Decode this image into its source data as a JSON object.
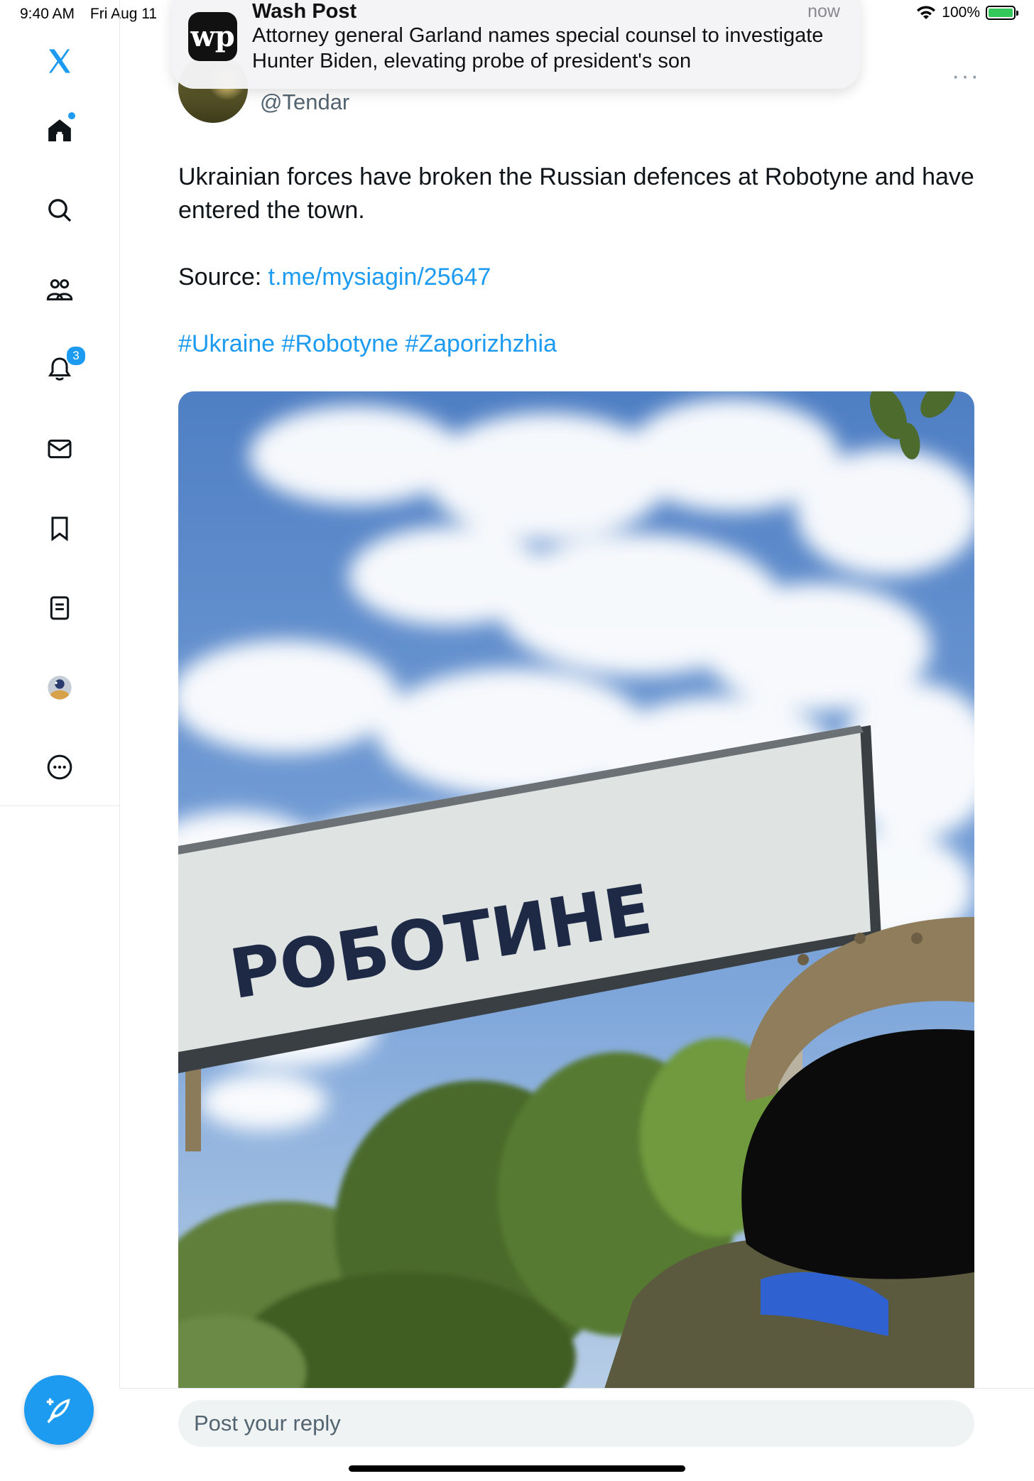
{
  "status_bar": {
    "time": "9:40 AM",
    "date": "Fri Aug 11",
    "battery": "100%"
  },
  "sidebar": {
    "items": [
      {
        "name": "x-logo",
        "icon": "x-logo-icon"
      },
      {
        "name": "home",
        "icon": "home-icon"
      },
      {
        "name": "explore",
        "icon": "search-icon"
      },
      {
        "name": "communities",
        "icon": "communities-icon"
      },
      {
        "name": "notifications",
        "icon": "bell-icon",
        "badge": "3"
      },
      {
        "name": "messages",
        "icon": "mail-icon"
      },
      {
        "name": "bookmarks",
        "icon": "bookmark-icon"
      },
      {
        "name": "lists",
        "icon": "list-icon"
      },
      {
        "name": "profile",
        "icon": "avatar-icon"
      },
      {
        "name": "more",
        "icon": "more-circle-icon"
      }
    ],
    "accent": "#1d9bf0"
  },
  "notification": {
    "app": "Wash Post",
    "logo_text": "wp",
    "time": "now",
    "body": "Attorney general Garland names special counsel to investigate Hunter Biden, elevating probe of president's son"
  },
  "tweet": {
    "handle": "@Tendar",
    "more": "···",
    "text": "Ukrainian forces have broken the Russian defences at Robotyne and have entered the town.",
    "source_label": "Source: ",
    "source_link": "t.me/mysiagin/25647",
    "hashtags": [
      "#Ukraine",
      "#Robotyne",
      "#Zaporizhzhia"
    ],
    "image": {
      "sign_text": "РОБОТИНЕ"
    }
  },
  "reply": {
    "placeholder": "Post your reply"
  }
}
